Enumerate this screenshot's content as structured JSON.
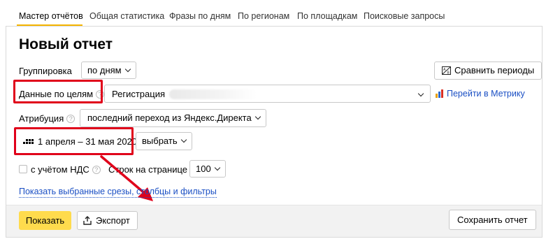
{
  "tabs": [
    {
      "label": "Мастер отчётов",
      "active": true
    },
    {
      "label": "Общая статистика",
      "active": false
    },
    {
      "label": "Фразы по дням",
      "active": false
    },
    {
      "label": "По регионам",
      "active": false
    },
    {
      "label": "По площадкам",
      "active": false
    },
    {
      "label": "Поисковые запросы",
      "active": false
    }
  ],
  "report": {
    "title": "Новый отчет",
    "grouping": {
      "label": "Группировка",
      "value": "по дням"
    },
    "compare_periods": "Сравнить периоды",
    "goals": {
      "label": "Данные по целям",
      "value": "Регистрация"
    },
    "metrika_link": "Перейти в Метрику",
    "attribution": {
      "label": "Атрибуция",
      "value": "последний переход из Яндекс.Директа"
    },
    "date_range": "1 апреля – 31 мая 2020",
    "choose": "выбрать",
    "vat": {
      "label": "с учётом НДС",
      "checked": false
    },
    "rows_per_page": {
      "label": "Строк на странице",
      "value": "100"
    },
    "show_selected": "Показать выбранные срезы, столбцы и фильтры",
    "help_glyph": "?"
  },
  "footer": {
    "show": "Показать",
    "export": "Экспорт",
    "save": "Сохранить отчет"
  },
  "colors": {
    "accent_yellow": "#ffdb4d",
    "tab_underline": "#f5b400",
    "link": "#1a4fc4",
    "highlight_red": "#e0001a"
  },
  "icons": [
    "compare-periods-icon",
    "metrika-icon",
    "calendar-icon",
    "export-icon",
    "help-icon",
    "chevron-down-icon"
  ]
}
